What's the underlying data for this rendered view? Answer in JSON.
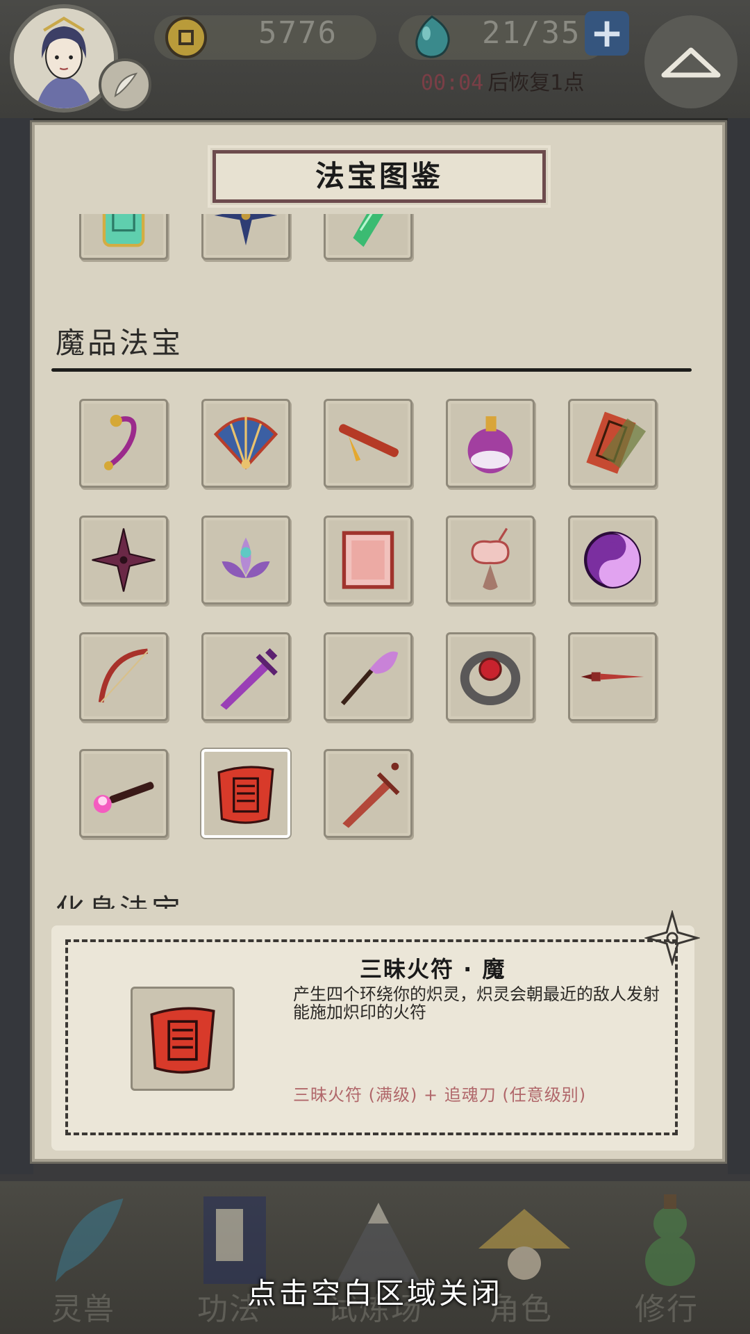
{
  "header": {
    "coins": "5776",
    "stamina": "21/35",
    "recover_time": "00:04",
    "recover_text": "后恢复1点"
  },
  "dialog": {
    "title": "法宝图鉴",
    "prev_section_items": [
      "scroll-jade-icon",
      "shuriken-blue-icon",
      "jade-talisman-icon"
    ],
    "section_title": "魔品法宝",
    "items": [
      "rope-icon",
      "fan-icon",
      "flute-icon",
      "gourd-purple-icon",
      "fire-talisman-icon",
      "shuriken-icon",
      "lotus-icon",
      "seal-red-icon",
      "cloud-pendant-icon",
      "yinyang-icon",
      "bow-icon",
      "sword-purple-icon",
      "whisk-icon",
      "ring-icon",
      "dagger-icon",
      "fire-torch-icon",
      "red-scroll-icon",
      "red-sword-icon"
    ],
    "selected_index": 16,
    "next_section_title": "化身法宝",
    "detail": {
      "name": "三昧火符 · 魔",
      "description": "产生四个环绕你的炽灵，炽灵会朝最近的敌人发射能施加炽印的火符",
      "recipe": "三昧火符 (满级)  +  追魂刀 (任意级别)"
    }
  },
  "nav": {
    "items": [
      "灵兽",
      "功法",
      "试炼场",
      "角色",
      "修行"
    ]
  },
  "close_hint": "点击空白区域关闭"
}
